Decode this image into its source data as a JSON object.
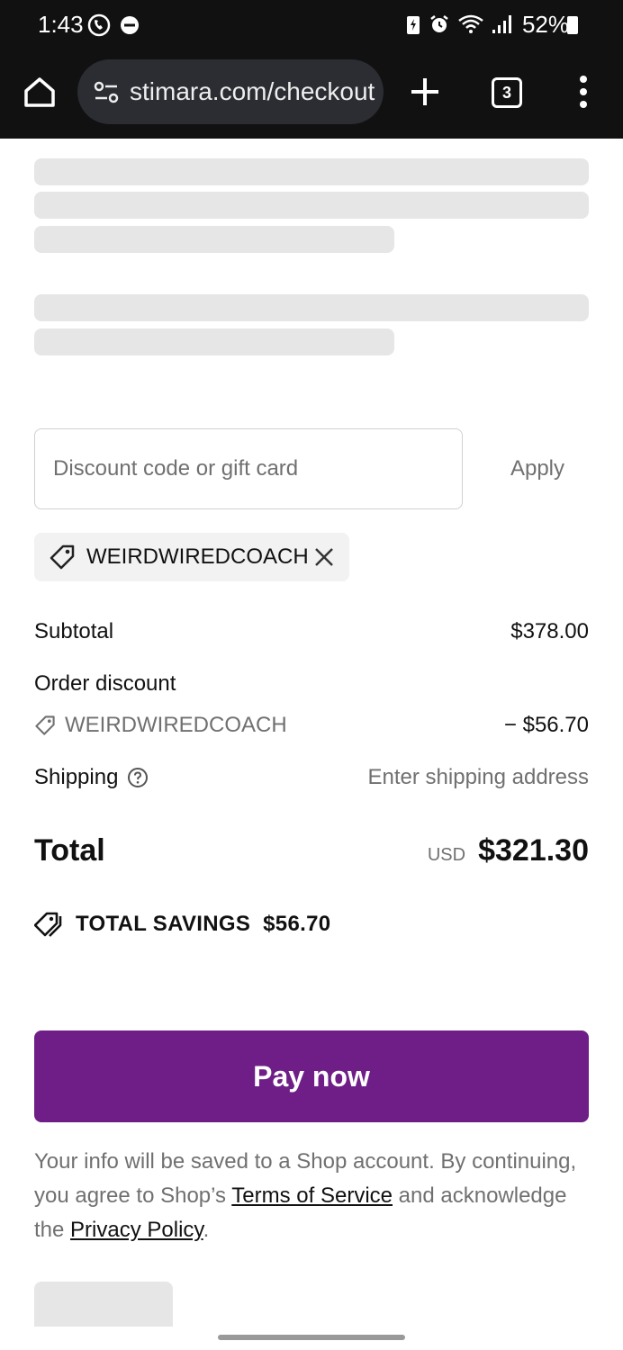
{
  "status_bar": {
    "time": "1:43",
    "battery_percent": "52%",
    "left_icons": [
      "whatsapp-icon",
      "do-not-disturb-icon"
    ],
    "right_icons": [
      "battery-saver-icon",
      "alarm-icon",
      "wifi-icon",
      "signal-icon"
    ]
  },
  "browser": {
    "url": "stimara.com/checkout",
    "tab_count": "3",
    "icons": [
      "home-icon",
      "site-settings-icon",
      "new-tab-icon",
      "tabs-icon",
      "menu-icon"
    ]
  },
  "discount": {
    "placeholder": "Discount code or gift card",
    "apply_label": "Apply",
    "applied_code": "WEIRDWIREDCOACH"
  },
  "summary": {
    "subtotal_label": "Subtotal",
    "subtotal_value": "$378.00",
    "order_discount_label": "Order discount",
    "discount_code": "WEIRDWIREDCOACH",
    "discount_value": "− $56.70",
    "shipping_label": "Shipping",
    "shipping_value": "Enter shipping address",
    "total_label": "Total",
    "currency": "USD",
    "total_value": "$321.30",
    "savings_label": "TOTAL SAVINGS",
    "savings_value": "$56.70"
  },
  "pay": {
    "label": "Pay now"
  },
  "legal": {
    "text_1": "Your info will be saved to a Shop account. By continuing, you agree to Shop’s ",
    "terms_link": "Terms of Service",
    "text_2": " and acknowledge the ",
    "privacy_link": "Privacy Policy",
    "text_3": "."
  },
  "colors": {
    "accent": "#6e1e86",
    "skeleton": "#e6e6e6",
    "muted_text": "#707070"
  }
}
